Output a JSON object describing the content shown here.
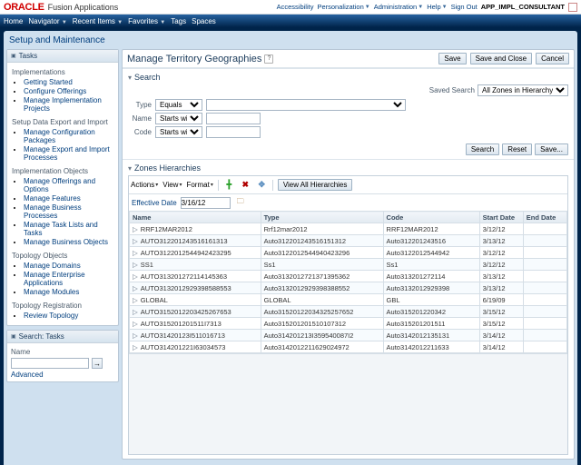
{
  "topbar": {
    "brand": "ORACLE",
    "app": "Fusion Applications",
    "links": [
      "Accessibility",
      "Personalization",
      "Administration",
      "Help",
      "Sign Out"
    ],
    "user": "APP_IMPL_CONSULTANT"
  },
  "nav": [
    "Home",
    "Navigator",
    "Recent Items",
    "Favorites",
    "Tags",
    "Spaces"
  ],
  "pageTitle": "Setup and Maintenance",
  "tasks": {
    "title": "Tasks",
    "groups": [
      {
        "title": "Implementations",
        "items": [
          "Getting Started",
          "Configure Offerings",
          "Manage Implementation Projects"
        ]
      },
      {
        "title": "Setup Data Export and Import",
        "items": [
          "Manage Configuration Packages",
          "Manage Export and Import Processes"
        ]
      },
      {
        "title": "Implementation Objects",
        "items": [
          "Manage Offerings and Options",
          "Manage Features",
          "Manage Business Processes",
          "Manage Task Lists and Tasks",
          "Manage Business Objects"
        ]
      },
      {
        "title": "Topology Objects",
        "items": [
          "Manage Domains",
          "Manage Enterprise Applications",
          "Manage Modules"
        ]
      },
      {
        "title": "Topology Registration",
        "items": [
          "Review Topology"
        ]
      }
    ]
  },
  "searchTasks": {
    "title": "Search: Tasks",
    "label": "Name",
    "advanced": "Advanced",
    "go": "→"
  },
  "main": {
    "title": "Manage Territory Geographies",
    "buttons": {
      "save": "Save",
      "saveClose": "Save and Close",
      "cancel": "Cancel"
    },
    "search": {
      "title": "Search",
      "savedLabel": "Saved Search",
      "savedSel": "All Zones in Hierarchy",
      "type": {
        "label": "Type",
        "op": "Equals",
        "val": ""
      },
      "name": {
        "label": "Name",
        "op": "Starts with",
        "val": ""
      },
      "code": {
        "label": "Code",
        "op": "Starts with",
        "val": ""
      },
      "btns": {
        "search": "Search",
        "reset": "Reset",
        "save": "Save..."
      }
    },
    "zones": {
      "title": "Zones Hierarchies",
      "menus": [
        "Actions",
        "View",
        "Format"
      ],
      "view": "View All Hierarchies",
      "eff": {
        "label": "Effective Date",
        "val": "3/16/12"
      },
      "cols": [
        "Name",
        "Type",
        "Code",
        "Start Date",
        "End Date"
      ],
      "rows": [
        [
          "RRF12MAR2012",
          "Rrf12mar2012",
          "RRF12MAR2012",
          "3/12/12",
          ""
        ],
        [
          "AUTO312201243516161313",
          "Auto31220124351615131­2",
          "Auto31220124­3516·3/13/12",
          ""
        ],
        [
          "AUTO3122012544942423295",
          "Auto312201254494042329­6",
          "Auto31220125­44942·3/12/12",
          ""
        ],
        [
          "SS1",
          "Ss1",
          "Ss1",
          "3/12/12",
          ""
        ],
        [
          "AUTO313201272114145363",
          "Auto3132012721371395362",
          "Auto31320127­2114·3/13/12",
          ""
        ],
        [
          "AUTO3132012929398588553",
          "Auto31320129293­98388552",
          "Auto31320129­29398·3/13/12",
          ""
        ],
        [
          "GLOBAL",
          "GLOBAL",
          "GBL",
          "6/19/09",
          ""
        ],
        [
          "AUTO31520122034­25267653",
          "Auto31520122034325257652",
          "Auto315201220342·3/15/12",
          ""
        ],
        [
          "AUTO315201201511I73­13",
          "Auto315201201510107312",
          "Auto31520120­1511·3/15/12",
          ""
        ],
        [
          "AUTO31420123I511016713",
          "Auto314201213­I359540087I2",
          "Auto31420121­35131·3/14/12",
          ""
        ],
        [
          "AUTO314201221I63034573",
          "Auto3142012211629024972",
          "Auto31420122­11633·3/14/12",
          ""
        ]
      ]
    }
  }
}
